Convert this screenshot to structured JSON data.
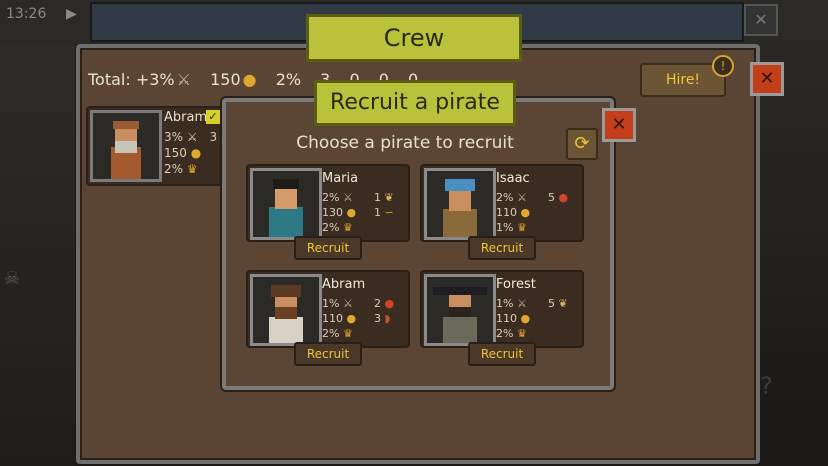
{
  "hud": {
    "clock": "13:26",
    "play_icon": "▶"
  },
  "crew_panel": {
    "title": "Crew",
    "stats": {
      "total": "Total: +3%",
      "gold": "150",
      "stat_pct": "2%",
      "count_a": "3",
      "count_b": "0",
      "count_c": "0",
      "count_d": "0"
    },
    "hire_label": "Hire!",
    "hire_alert": "!",
    "close_icon": "✕",
    "member": {
      "name": "Abram",
      "row1": "3%",
      "row1b": "3",
      "row2": "150",
      "row3": "2%",
      "checked": "✓"
    }
  },
  "recruit_dialog": {
    "title": "Recruit a pirate",
    "subtitle": "Choose a pirate to recruit",
    "close_icon": "✕",
    "refresh_icon": "⟳",
    "recruit_label": "Recruit",
    "pirates": [
      {
        "name": "Maria",
        "combat": "2%",
        "cost": "130",
        "trophy": "2%",
        "res1": "1",
        "res1_icon": "wheat-icon",
        "res2": "1",
        "res2_icon": "rope-icon"
      },
      {
        "name": "Isaac",
        "combat": "2%",
        "cost": "110",
        "trophy": "1%",
        "res1": "5",
        "res1_icon": "apple-icon"
      },
      {
        "name": "Abram",
        "combat": "1%",
        "cost": "110",
        "trophy": "2%",
        "res1": "2",
        "res1_icon": "apple-icon",
        "res2": "3",
        "res2_icon": "meat-icon"
      },
      {
        "name": "Forest",
        "combat": "1%",
        "cost": "110",
        "trophy": "2%",
        "res1": "5",
        "res1_icon": "wheat-icon"
      }
    ]
  },
  "colors": {
    "banner": "#b9c23a",
    "panel": "#5a4534",
    "accent": "#f0c63a",
    "close": "#c23f1a"
  }
}
